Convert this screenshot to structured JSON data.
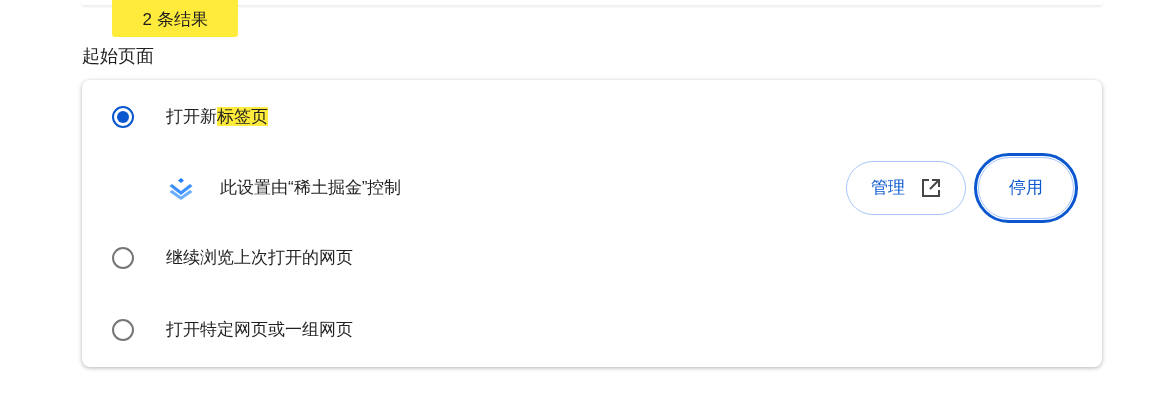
{
  "search_results_badge": "2 条结果",
  "section_title": "起始页面",
  "options": [
    {
      "kind": "radio",
      "selected": true,
      "label_parts": [
        {
          "text": "打开新",
          "highlighted": false
        },
        {
          "text": "标签页",
          "highlighted": true
        }
      ]
    },
    {
      "kind": "extension_notice",
      "text": "此设置由“稀土掘金”控制",
      "buttons": [
        {
          "label": "管理",
          "external": true,
          "focused": false
        },
        {
          "label": "停用",
          "external": false,
          "focused": true
        }
      ]
    },
    {
      "kind": "radio",
      "selected": false,
      "label_parts": [
        {
          "text": "继续浏览上次打开的网页",
          "highlighted": false
        }
      ]
    },
    {
      "kind": "radio",
      "selected": false,
      "label_parts": [
        {
          "text": "打开特定网页或一组网页",
          "highlighted": false
        }
      ]
    }
  ]
}
